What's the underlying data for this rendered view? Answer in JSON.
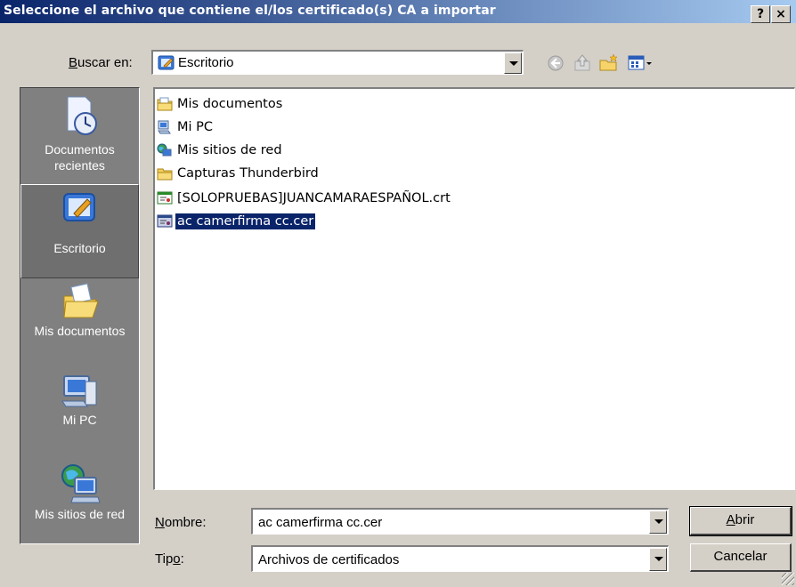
{
  "window": {
    "title": "Seleccione el archivo que contiene el/los certificado(s) CA a importar",
    "help_button": "?",
    "close_button": "×"
  },
  "lookin": {
    "label_pre": "",
    "label_ul": "B",
    "label_post": "uscar en:",
    "value": "Escritorio"
  },
  "toolbar": {
    "icons": [
      "back-icon",
      "up-folder-icon",
      "new-folder-icon",
      "view-menu-icon"
    ]
  },
  "places": [
    {
      "label": "Documentos recientes",
      "icon": "recent-documents-icon"
    },
    {
      "label": "Escritorio",
      "icon": "desktop-icon",
      "selected": true
    },
    {
      "label": "Mis documentos",
      "icon": "my-documents-icon"
    },
    {
      "label": "Mi PC",
      "icon": "my-computer-icon"
    },
    {
      "label": "Mis sitios de red",
      "icon": "network-places-icon"
    }
  ],
  "files": [
    {
      "name": "Mis documentos",
      "icon": "my-documents-folder-icon"
    },
    {
      "name": "Mi PC",
      "icon": "my-computer-icon"
    },
    {
      "name": "Mis sitios de red",
      "icon": "network-places-icon"
    },
    {
      "name": "Capturas Thunderbird",
      "icon": "folder-icon"
    },
    {
      "name": "[SOLOPRUEBAS]JUANCAMARAESPAÑOL.crt",
      "icon": "certificate-icon"
    },
    {
      "name": "ac camerfirma cc.cer",
      "icon": "certificate-icon",
      "selected": true
    }
  ],
  "filename": {
    "label_ul": "N",
    "label_post": "ombre:",
    "value": "ac camerfirma cc.cer"
  },
  "filetype": {
    "label_pre": "Tip",
    "label_ul": "o",
    "label_post": ":",
    "value": "Archivos de certificados"
  },
  "buttons": {
    "open_ul": "A",
    "open_post": "brir",
    "cancel": "Cancelar"
  },
  "colors": {
    "titlebar_start": "#0a246a",
    "titlebar_end": "#a6caf0",
    "selection": "#0a246a",
    "face": "#d4d0c8"
  }
}
